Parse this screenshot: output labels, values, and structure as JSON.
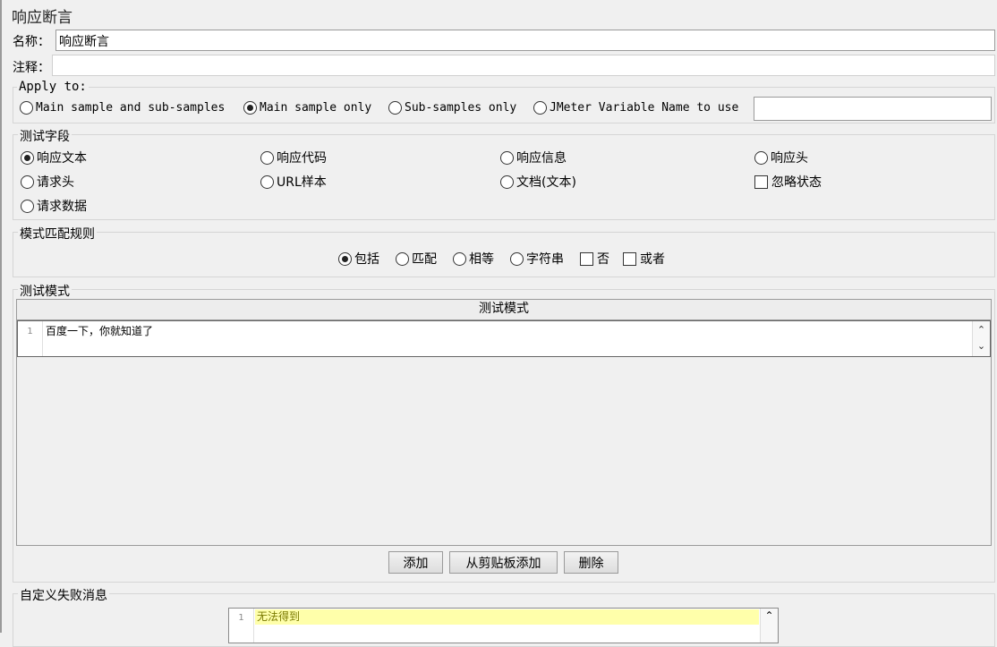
{
  "title": "响应断言",
  "name_field": {
    "label": "名称：",
    "value": "响应断言"
  },
  "comment_field": {
    "label": "注释：",
    "value": ""
  },
  "apply_to": {
    "legend": "Apply to:",
    "options": [
      "Main sample and sub-samples",
      "Main sample only",
      "Sub-samples only",
      "JMeter Variable Name to use"
    ],
    "selected": "Main sample only",
    "variable_value": ""
  },
  "test_field": {
    "legend": "测试字段",
    "options": [
      "响应文本",
      "响应代码",
      "响应信息",
      "响应头",
      "请求头",
      "URL样本",
      "文档(文本)",
      "请求数据"
    ],
    "selected": "响应文本",
    "ignore_status_label": "忽略状态",
    "ignore_status_checked": false
  },
  "pattern_rule": {
    "legend": "模式匹配规则",
    "options": [
      "包括",
      "匹配",
      "相等",
      "字符串"
    ],
    "selected": "包括",
    "not_label": "否",
    "or_label": "或者"
  },
  "test_patterns": {
    "legend": "测试模式",
    "column_header": "测试模式",
    "rows": [
      {
        "line": "1",
        "text": "百度一下，你就知道了"
      }
    ]
  },
  "buttons": {
    "add": "添加",
    "add_from_clipboard": "从剪贴板添加",
    "delete": "删除"
  },
  "failure_message": {
    "legend": "自定义失败消息",
    "line": "1",
    "text": "无法得到"
  },
  "icons": {
    "scroll_up": "chevron-up-icon",
    "scroll_down": "chevron-down-icon"
  }
}
